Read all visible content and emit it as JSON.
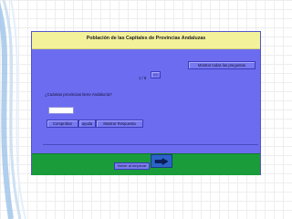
{
  "app": {
    "title": "Población de las Capitales de Provincias Andaluzas"
  },
  "toolbar": {
    "show_all_label": "Mostrar todas las preguntas",
    "prev_label": "<<",
    "pager_text": "1 / 8"
  },
  "question": {
    "text": "¿Cuántas provincias tiene Andalucía?",
    "answer_value": ""
  },
  "actions": {
    "check_label": "Comprobar",
    "help_label": "ayuda",
    "show_answer_label": "Mostrar Respuesta"
  },
  "footer": {
    "restart_label": "Volver al empezar",
    "next_icon": "right-arrow-icon"
  },
  "colors": {
    "panel": "#6c6cf0",
    "titlebar": "#f3f19a",
    "footer": "#1a9c3a",
    "next_button": "#2b63c9"
  }
}
